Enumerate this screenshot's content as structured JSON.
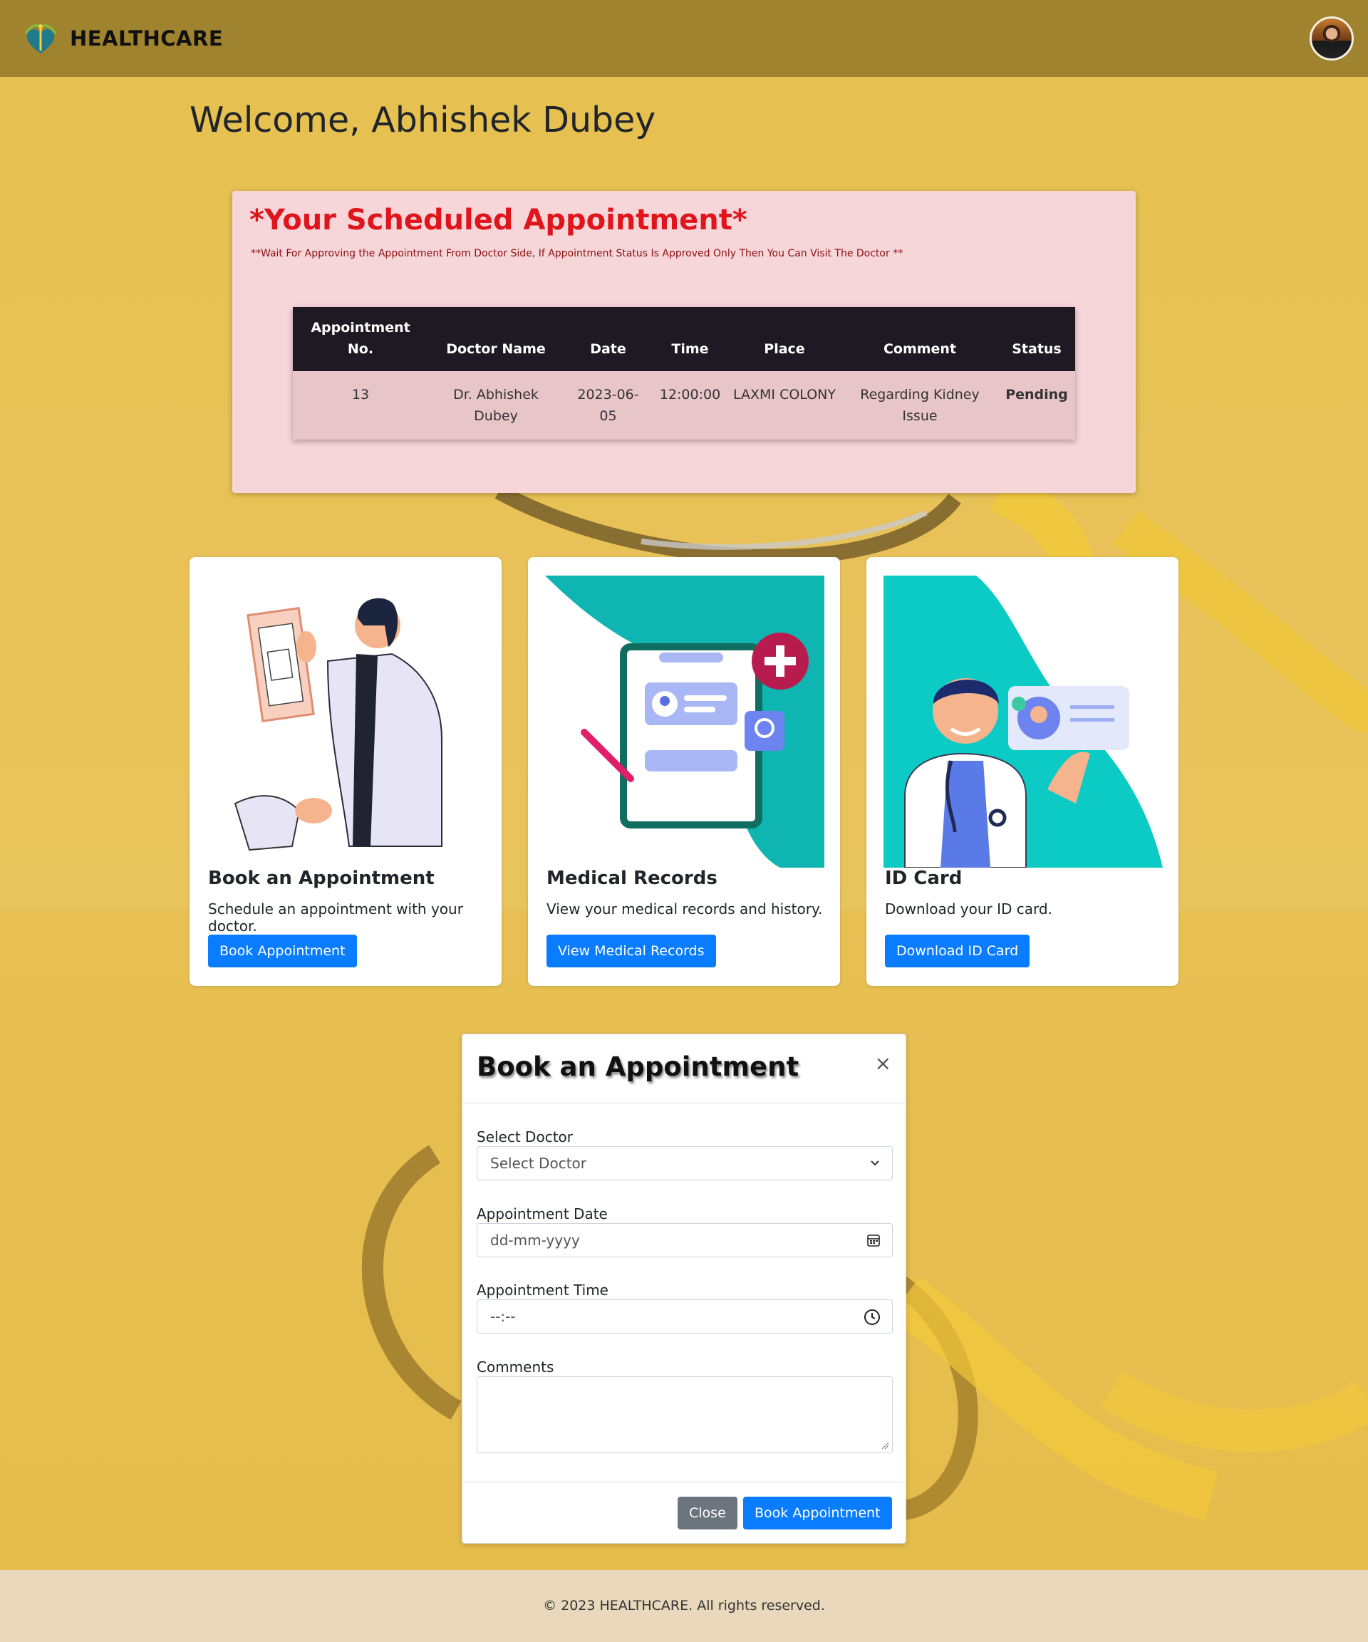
{
  "navbar": {
    "brand": "HEALTHCARE",
    "logo_tagline": "HEALTH CARE",
    "logo_icon": "caduceus-heart-icon",
    "avatar_icon": "user-avatar"
  },
  "welcome": "Welcome, Abhishek Dubey",
  "scheduled": {
    "title": "*Your Scheduled Appointment*",
    "note": "**Wait For Approving the Appointment From Doctor Side, If Appointment Status Is Approved Only Then You Can Visit The Doctor **",
    "headers": [
      "Appointment No.",
      "Doctor Name",
      "Date",
      "Time",
      "Place",
      "Comment",
      "Status"
    ],
    "rows": [
      {
        "no": "13",
        "doctor": "Dr. Abhishek Dubey",
        "date": "2023-06-05",
        "time": "12:00:00",
        "place": "LAXMI COLONY",
        "comment": "Regarding Kidney Issue",
        "status": "Pending"
      }
    ]
  },
  "cards": [
    {
      "title": "Book an Appointment",
      "text": "Schedule an appointment with your doctor.",
      "button": "Book Appointment",
      "illustration": "doctor-with-clipboard-illustration"
    },
    {
      "title": "Medical Records",
      "text": "View your medical records and history.",
      "button": "View Medical Records",
      "illustration": "medical-clipboard-illustration"
    },
    {
      "title": "ID Card",
      "text": "Download your ID card.",
      "button": "Download ID Card",
      "illustration": "doctor-id-card-illustration"
    }
  ],
  "modal": {
    "title": "Book an Appointment",
    "close_icon": "×",
    "doctor_label": "Select Doctor",
    "doctor_value": "Select Doctor",
    "date_label": "Appointment Date",
    "date_placeholder": "dd-mm-yyyy",
    "time_label": "Appointment Time",
    "time_placeholder": "--:--",
    "comments_label": "Comments",
    "close_button": "Close",
    "submit_button": "Book Appointment"
  },
  "footer": "© 2023 HEALTHCARE. All rights reserved.",
  "colors": {
    "navbar": "#a0832f",
    "accent_red": "#e0141b",
    "primary_button": "#0a7cff",
    "panel_pink": "#f7d6da",
    "footer": "#e9d8bc"
  }
}
